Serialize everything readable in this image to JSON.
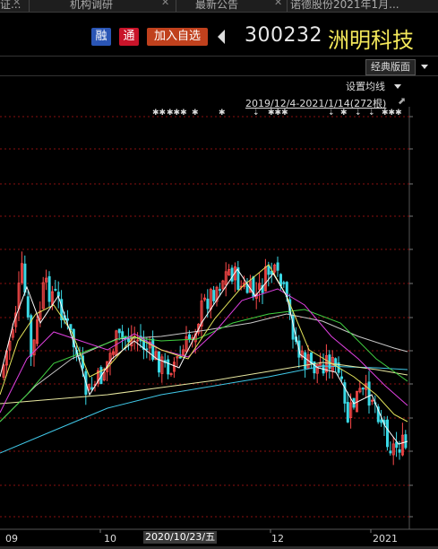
{
  "tabs": [
    {
      "label": "证..."
    },
    {
      "label": "机构调研"
    },
    {
      "label": "最新公告"
    },
    {
      "label": "诺德股份2021年1月..."
    }
  ],
  "tab_close": "✕",
  "header": {
    "badge_rong": "融",
    "badge_tong": "通",
    "add_watchlist": "加入自选",
    "stock_code": "300232",
    "stock_name": "洲明科技"
  },
  "toolbar": {
    "classic_layout": "经典版面"
  },
  "chart_panel": {
    "ma_setting": "设置均线",
    "date_range": "2019/12/4-2021/1/14(272根)"
  },
  "x_axis": {
    "labels": [
      "09",
      "10",
      "2020/10/23/五",
      "12",
      "2021"
    ]
  },
  "colors": {
    "up": "#ff4a4a",
    "down": "#3ad9e6",
    "ma5": "#ffffff",
    "ma10": "#e3e35a",
    "ma20": "#e040e0",
    "ma30": "#40d040",
    "ma60": "#c8c8c8",
    "ma120": "#e8e8a0",
    "ma250": "#40c8e8",
    "grid": "#8a1010",
    "stock_name": "#f3e85a"
  },
  "chart_data": {
    "type": "candlestick",
    "title": "",
    "xlabel": "",
    "ylabel": "",
    "x": [
      "09",
      "10",
      "2020/10/23/五",
      "12",
      "2021"
    ],
    "series": [
      {
        "values": []
      }
    ]
  }
}
